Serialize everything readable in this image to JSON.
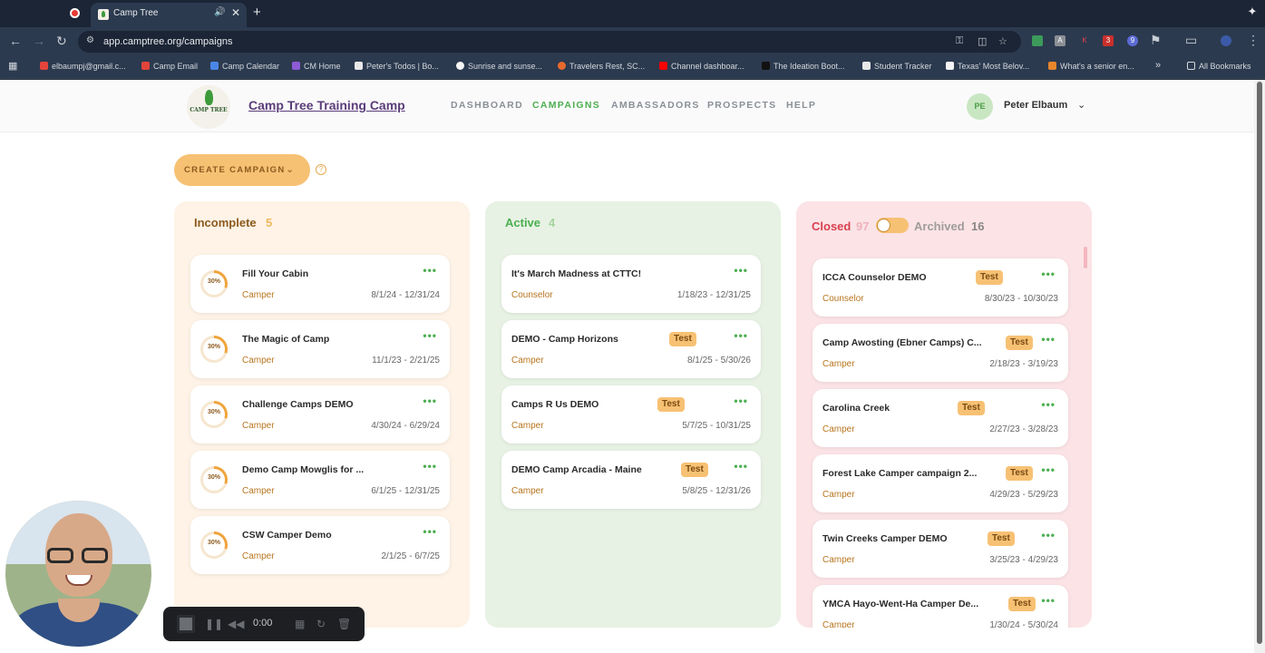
{
  "browser": {
    "tab_title": "Camp Tree",
    "url": "app.camptree.org/campaigns",
    "bookmarks": [
      "elbaumpj@gmail.c...",
      "Camp Email",
      "Camp Calendar",
      "CM Home",
      "Peter's Todos | Bo...",
      "Sunrise and sunse...",
      "Travelers Rest, SC...",
      "Channel dashboar...",
      "The Ideation Boot...",
      "Student Tracker",
      "Texas' Most Belov...",
      "What's a senior en..."
    ],
    "all_bookmarks": "All Bookmarks",
    "extension_badges": [
      "3",
      "9"
    ]
  },
  "header": {
    "logo_text": "CAMP TREE",
    "org_name": "Camp Tree Training Camp",
    "nav": [
      "DASHBOARD",
      "CAMPAIGNS",
      "AMBASSADORS",
      "PROSPECTS",
      "HELP"
    ],
    "active_nav": "CAMPAIGNS",
    "user_initials": "PE",
    "user_name": "Peter Elbaum"
  },
  "actions": {
    "create_label": "CREATE CAMPAIGN",
    "help": "?"
  },
  "columns": {
    "incomplete": {
      "title": "Incomplete",
      "count": "5",
      "cards": [
        {
          "title": "Fill Your Cabin",
          "type": "Camper",
          "dates": "8/1/24 - 12/31/24",
          "progress": "30%"
        },
        {
          "title": "The Magic of Camp",
          "type": "Camper",
          "dates": "11/1/23 - 2/21/25",
          "progress": "30%"
        },
        {
          "title": "Challenge Camps DEMO",
          "type": "Camper",
          "dates": "4/30/24 - 6/29/24",
          "progress": "30%"
        },
        {
          "title": "Demo Camp Mowglis for ...",
          "type": "Camper",
          "dates": "6/1/25 - 12/31/25",
          "progress": "30%"
        },
        {
          "title": "CSW Camper Demo",
          "type": "Camper",
          "dates": "2/1/25 - 6/7/25",
          "progress": "30%"
        }
      ]
    },
    "active": {
      "title": "Active",
      "count": "4",
      "cards": [
        {
          "title": "It's March Madness at CTTC!",
          "type": "Counselor",
          "dates": "1/18/23 - 12/31/25",
          "badge": ""
        },
        {
          "title": "DEMO - Camp Horizons",
          "type": "Camper",
          "dates": "8/1/25 - 5/30/26",
          "badge": "Test"
        },
        {
          "title": "Camps R Us DEMO",
          "type": "Camper",
          "dates": "5/7/25 - 10/31/25",
          "badge": "Test"
        },
        {
          "title": "DEMO Camp Arcadia - Maine",
          "type": "Camper",
          "dates": "5/8/25 - 12/31/26",
          "badge": "Test"
        }
      ]
    },
    "closed": {
      "title": "Closed",
      "count": "97",
      "archived_title": "Archived",
      "archived_count": "16",
      "cards": [
        {
          "title": "ICCA Counselor DEMO",
          "type": "Counselor",
          "dates": "8/30/23 - 10/30/23",
          "badge": "Test"
        },
        {
          "title": "Camp Awosting (Ebner Camps) C...",
          "type": "Camper",
          "dates": "2/18/23 - 3/19/23",
          "badge": "Test"
        },
        {
          "title": "Carolina Creek",
          "type": "Camper",
          "dates": "2/27/23 - 3/28/23",
          "badge": "Test"
        },
        {
          "title": "Forest Lake Camper campaign 2...",
          "type": "Camper",
          "dates": "4/29/23 - 5/29/23",
          "badge": "Test"
        },
        {
          "title": "Twin Creeks Camper DEMO",
          "type": "Camper",
          "dates": "3/25/23 - 4/29/23",
          "badge": "Test"
        },
        {
          "title": "YMCA Hayo-Went-Ha Camper De...",
          "type": "Camper",
          "dates": "1/30/24 - 5/30/24",
          "badge": "Test"
        }
      ]
    }
  },
  "recorder": {
    "time": "0:00"
  },
  "colors": {
    "accent_green": "#4caf50",
    "accent_orange": "#f7c174",
    "incomplete_bg": "#fef3e6",
    "active_bg": "#e7f2e4",
    "closed_bg": "#fbe3e6",
    "closed_title": "#d9404f"
  }
}
